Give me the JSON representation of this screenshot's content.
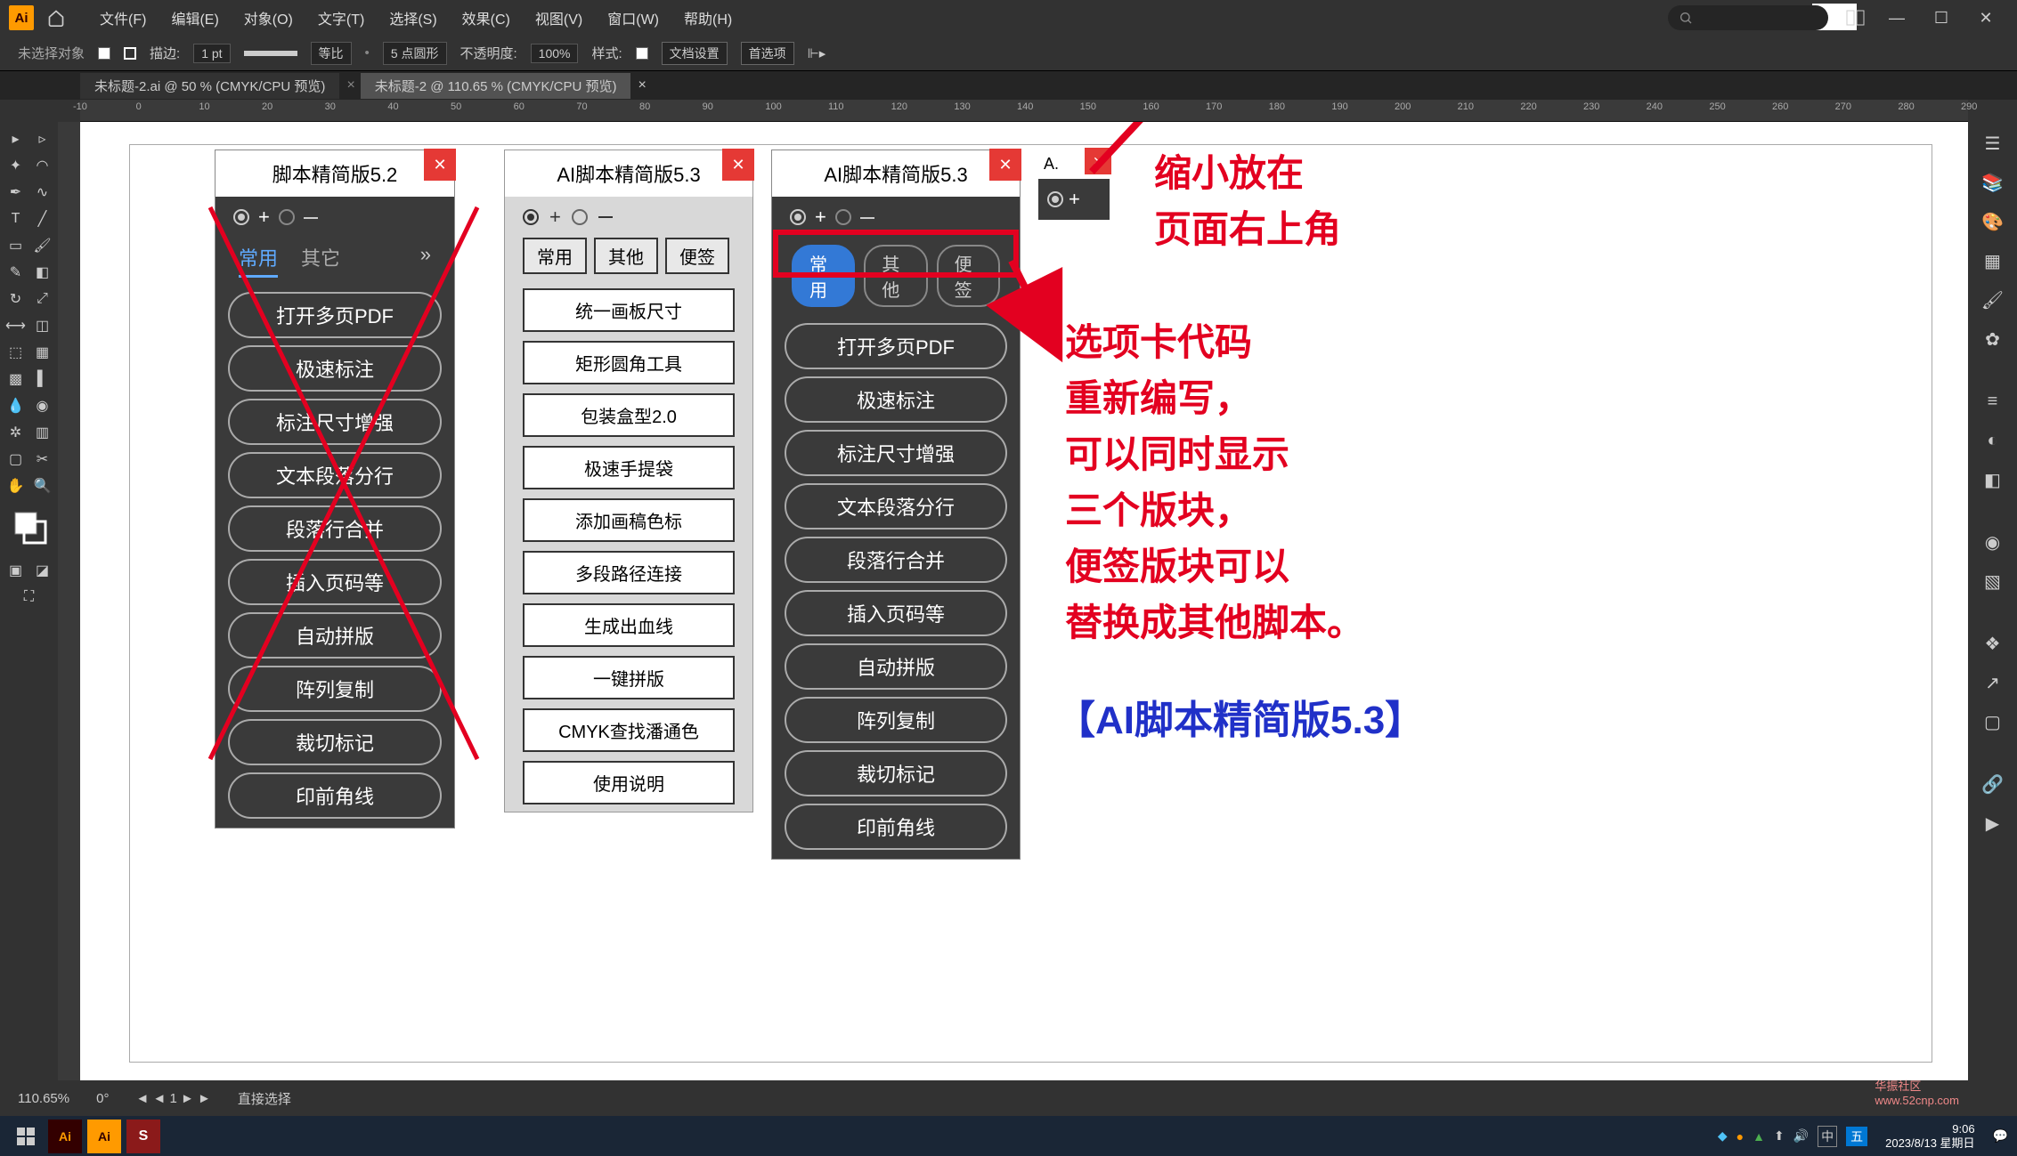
{
  "menu": {
    "file": "文件(F)",
    "edit": "编辑(E)",
    "object": "对象(O)",
    "type": "文字(T)",
    "select": "选择(S)",
    "effect": "效果(C)",
    "view": "视图(V)",
    "window": "窗口(W)",
    "help": "帮助(H)"
  },
  "ctrl": {
    "noSelect": "未选择对象",
    "stroke": "描边:",
    "strokeVal": "1 pt",
    "uniform": "等比",
    "pt5": "5 点圆形",
    "opacity": "不透明度:",
    "opacityVal": "100%",
    "style": "样式:",
    "docSetup": "文档设置",
    "prefs": "首选项"
  },
  "tabs": {
    "t1": "未标题-2.ai @ 50 % (CMYK/CPU 预览)",
    "t2": "未标题-2 @ 110.65 % (CMYK/CPU 预览)"
  },
  "panel52": {
    "title": "脚本精简版5.2",
    "tabs": [
      "常用",
      "其它"
    ],
    "items": [
      "打开多页PDF",
      "极速标注",
      "标注尺寸增强",
      "文本段落分行",
      "段落行合并",
      "插入页码等",
      "自动拼版",
      "阵列复制",
      "裁切标记",
      "印前角线"
    ]
  },
  "panel53w": {
    "title": "AI脚本精简版5.3",
    "tabs": [
      "常用",
      "其他",
      "便签"
    ],
    "items": [
      "统一画板尺寸",
      "矩形圆角工具",
      "包装盒型2.0",
      "极速手提袋",
      "添加画稿色标",
      "多段路径连接",
      "生成出血线",
      "一键拼版",
      "CMYK查找潘通色",
      "使用说明"
    ]
  },
  "panel53d": {
    "title": "AI脚本精简版5.3",
    "tabs": [
      "常用",
      "其他",
      "便签"
    ],
    "items": [
      "打开多页PDF",
      "极速标注",
      "标注尺寸增强",
      "文本段落分行",
      "段落行合并",
      "插入页码等",
      "自动拼版",
      "阵列复制",
      "裁切标记",
      "印前角线"
    ]
  },
  "mini": {
    "title": "A."
  },
  "miniTop": {
    "text": "A."
  },
  "anno": {
    "l1": "缩小放在",
    "l2": "页面右上角",
    "l3": "选项卡代码",
    "l4": "重新编写，",
    "l5": "可以同时显示",
    "l6": "三个版块，",
    "l7": "便签版块可以",
    "l8": "替换成其他脚本。",
    "blue": "【AI脚本精简版5.3】"
  },
  "status": {
    "zoom": "110.65%",
    "sel": "直接选择"
  },
  "clock": {
    "time": "9:06",
    "date": "2023/8/13 星期日"
  },
  "ruler": [
    -10,
    0,
    10,
    20,
    30,
    40,
    50,
    60,
    70,
    80,
    90,
    100,
    110,
    120,
    130,
    140,
    150,
    160,
    170,
    180,
    190,
    200,
    210,
    220,
    230,
    240,
    250,
    260,
    270,
    280,
    290
  ]
}
